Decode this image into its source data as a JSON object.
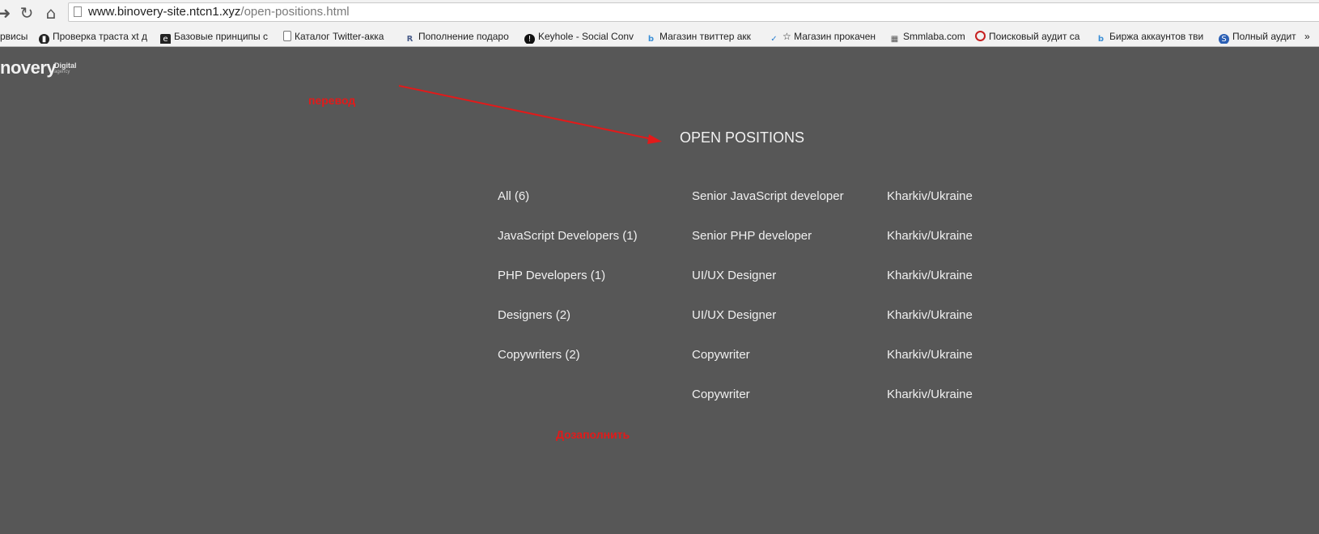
{
  "browser": {
    "url_host": "www.binovery-site.ntcn1.xyz",
    "url_path": "/open-positions.html",
    "bookmarks": [
      {
        "label": "рвисы",
        "icon": "folder-icon"
      },
      {
        "label": "Проверка траста xt д",
        "icon": "chart-icon"
      },
      {
        "label": "Базовые принципы с",
        "icon": "eye-icon"
      },
      {
        "label": "Каталог Twitter-акка",
        "icon": "page-icon"
      },
      {
        "label": "Пополнение подаро",
        "icon": "r-icon"
      },
      {
        "label": "Keyhole - Social Conv",
        "icon": "keyhole-icon"
      },
      {
        "label": "Магазин твиттер акк",
        "icon": "bird-icon"
      },
      {
        "label": "☆ Магазин прокачен",
        "icon": "bird-icon"
      },
      {
        "label": "Smmlaba.com",
        "icon": "cart-icon"
      },
      {
        "label": "Поисковый аудит са",
        "icon": "audit-icon"
      },
      {
        "label": "Биржа аккаунтов тви",
        "icon": "bird-icon"
      },
      {
        "label": "Полный аудит",
        "icon": "s-icon"
      }
    ]
  },
  "logo": {
    "text": "novery",
    "tag_line1": "Digital",
    "tag_line2": "agency"
  },
  "annotations": {
    "translate": "перевод",
    "fill_in": "Дозаполнить"
  },
  "heading": "OPEN POSITIONS",
  "categories": [
    "All (6)",
    "JavaScript Developers (1)",
    "PHP Developers (1)",
    "Designers (2)",
    "Copywriters (2)"
  ],
  "positions": [
    {
      "title": "Senior JavaScript developer",
      "location": "Kharkiv/Ukraine"
    },
    {
      "title": "Senior PHP developer",
      "location": "Kharkiv/Ukraine"
    },
    {
      "title": "UI/UX Designer",
      "location": "Kharkiv/Ukraine"
    },
    {
      "title": "UI/UX Designer",
      "location": "Kharkiv/Ukraine"
    },
    {
      "title": "Copywriter",
      "location": "Kharkiv/Ukraine"
    },
    {
      "title": "Copywriter",
      "location": "Kharkiv/Ukraine"
    }
  ],
  "colors": {
    "page_bg": "#575757",
    "annotation": "#e21a1a",
    "text": "#f0f0f0"
  }
}
